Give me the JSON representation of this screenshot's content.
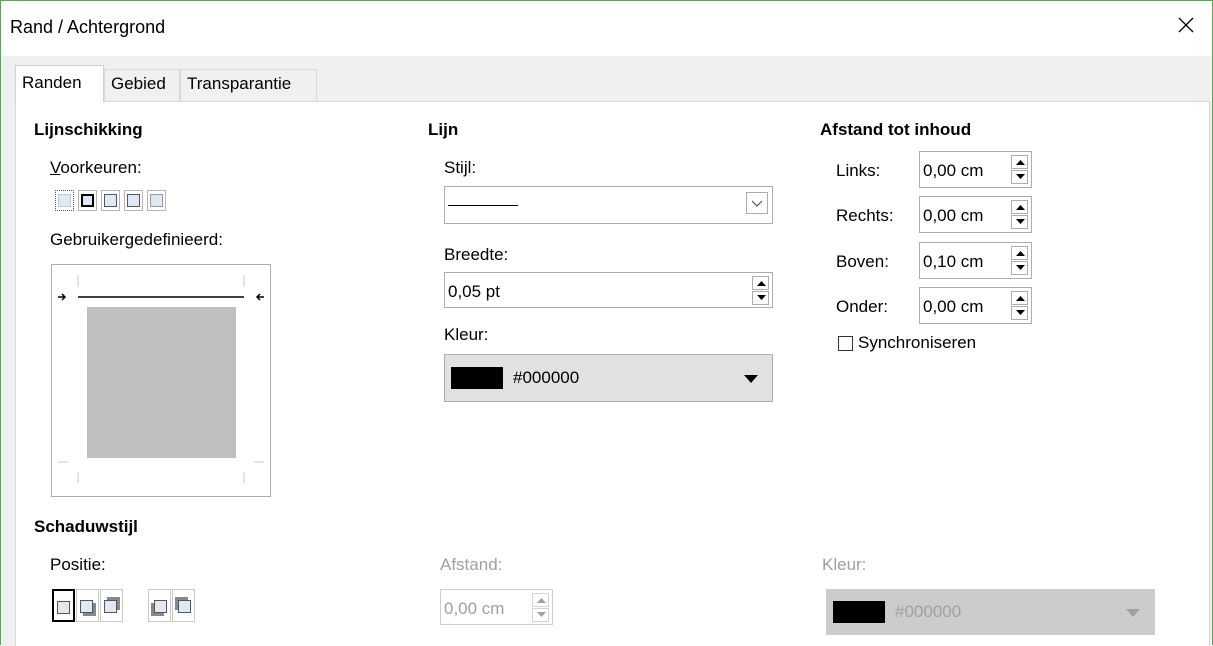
{
  "window": {
    "title": "Rand / Achtergrond"
  },
  "tabs": [
    {
      "label": "Randen"
    },
    {
      "label": "Gebied"
    },
    {
      "label": "Transparantie"
    }
  ],
  "line_arrangement": {
    "heading": "Lijnschikking",
    "presets_label": "Voorkeuren:",
    "user_defined_label": "Gebruikergedefinieerd:"
  },
  "line": {
    "heading": "Lijn",
    "style_label": "Stijl:",
    "width_label": "Breedte:",
    "width_value": "0,05 pt",
    "color_label": "Kleur:",
    "color_value": "#000000",
    "color_swatch": "#000000"
  },
  "padding": {
    "heading": "Afstand tot inhoud",
    "left_label": "Links:",
    "left_value": "0,00 cm",
    "right_label": "Rechts:",
    "right_value": "0,00 cm",
    "top_label": "Boven:",
    "top_value": "0,10 cm",
    "bottom_label": "Onder:",
    "bottom_value": "0,00 cm",
    "sync_label": "Synchroniseren",
    "sync_checked": false
  },
  "shadow": {
    "heading": "Schaduwstijl",
    "position_label": "Positie:",
    "distance_label": "Afstand:",
    "distance_value": "0,00 cm",
    "color_label": "Kleur:",
    "color_value": "#000000"
  },
  "icons": {
    "close": "close-icon",
    "dropdown": "chevron-down-icon",
    "spin_up": "arrow-up-icon",
    "spin_down": "arrow-down-icon"
  }
}
